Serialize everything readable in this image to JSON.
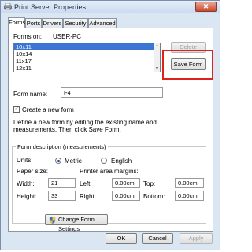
{
  "window": {
    "title": "Print Server Properties",
    "close_glyph": "✕"
  },
  "tabs": [
    {
      "label": "Forms",
      "active": true
    },
    {
      "label": "Ports",
      "active": false
    },
    {
      "label": "Drivers",
      "active": false
    },
    {
      "label": "Security",
      "active": false
    },
    {
      "label": "Advanced",
      "active": false
    }
  ],
  "forms": {
    "forms_on_label": "Forms on:",
    "server_name": "USER-PC",
    "list": [
      "10x11",
      "10x14",
      "11x17",
      "12x11"
    ],
    "selected": "10x11",
    "delete_label": "Delete",
    "save_form_label": "Save Form",
    "form_name_label": "Form name:",
    "form_name_value": "F4",
    "create_new_label": "Create a new form",
    "create_new_checked": true,
    "help_line1": "Define a new form by editing the existing name and",
    "help_line2": "measurements. Then click Save Form."
  },
  "measurements": {
    "group_title": "Form description (measurements)",
    "units_label": "Units:",
    "metric_label": "Metric",
    "english_label": "English",
    "selected_unit": "Metric",
    "paper_size_label": "Paper size:",
    "margins_label": "Printer area margins:",
    "width_label": "Width:",
    "width_value": "21",
    "height_label": "Height:",
    "height_value": "33",
    "left_label": "Left:",
    "left_value": "0.00cm",
    "right_label": "Right:",
    "right_value": "0.00cm",
    "top_label": "Top:",
    "top_value": "0.00cm",
    "bottom_label": "Bottom:",
    "bottom_value": "0.00cm"
  },
  "change_settings_label": "Change Form Settings",
  "footer": {
    "ok_label": "OK",
    "cancel_label": "Cancel",
    "apply_label": "Apply"
  },
  "colors": {
    "highlight_box": "#e0201e",
    "selection": "#3a75d4"
  }
}
